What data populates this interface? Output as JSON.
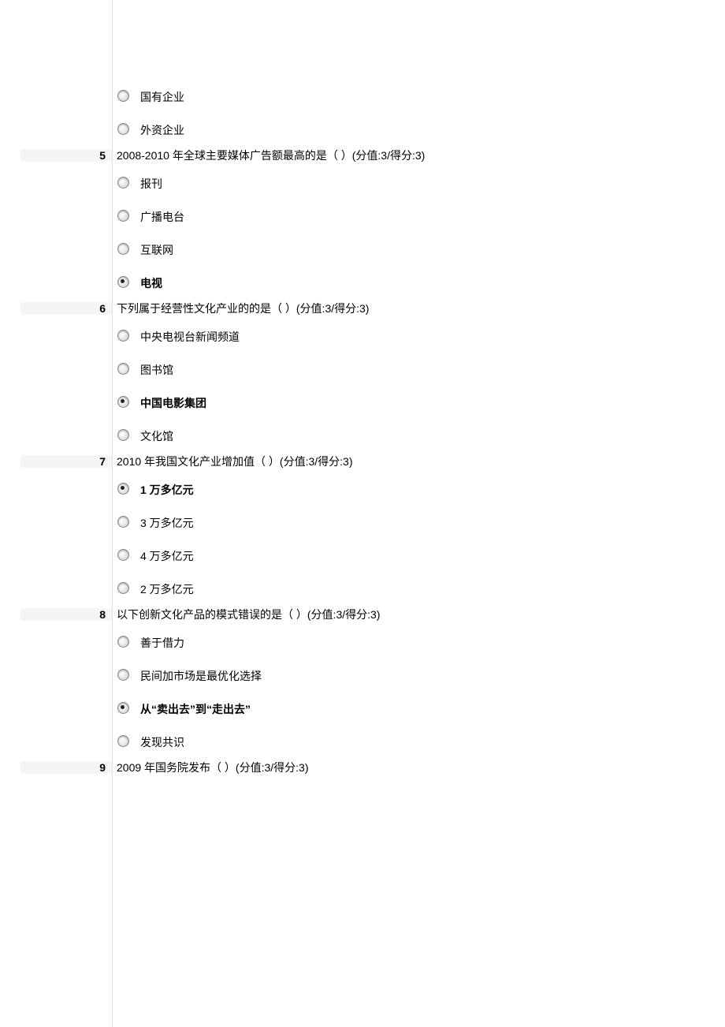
{
  "orphan_options": [
    {
      "label": "国有企业",
      "selected": false
    },
    {
      "label": "外资企业",
      "selected": false
    }
  ],
  "questions": [
    {
      "num": "5",
      "text": "2008-2010 年全球主要媒体广告额最高的是（ ）(分值:3/得分:3)",
      "options": [
        {
          "label": "报刊",
          "selected": false
        },
        {
          "label": "广播电台",
          "selected": false
        },
        {
          "label": "互联网",
          "selected": false
        },
        {
          "label": "电视",
          "selected": true
        }
      ]
    },
    {
      "num": "6",
      "text": "下列属于经营性文化产业的的是（ ）(分值:3/得分:3)",
      "options": [
        {
          "label": "中央电视台新闻频道",
          "selected": false
        },
        {
          "label": "图书馆",
          "selected": false
        },
        {
          "label": "中国电影集团",
          "selected": true
        },
        {
          "label": "文化馆",
          "selected": false
        }
      ]
    },
    {
      "num": "7",
      "text": "2010 年我国文化产业增加值（ ）(分值:3/得分:3)",
      "options": [
        {
          "label": "1 万多亿元",
          "selected": true
        },
        {
          "label": "3 万多亿元",
          "selected": false
        },
        {
          "label": "4 万多亿元",
          "selected": false
        },
        {
          "label": "2 万多亿元",
          "selected": false
        }
      ]
    },
    {
      "num": "8",
      "text": "以下创新文化产品的模式错误的是（ ）(分值:3/得分:3)",
      "options": [
        {
          "label": "善于借力",
          "selected": false
        },
        {
          "label": "民间加市场是最优化选择",
          "selected": false
        },
        {
          "label": "从“卖出去”到“走出去”",
          "selected": true
        },
        {
          "label": "发现共识",
          "selected": false
        }
      ]
    },
    {
      "num": "9",
      "text": "2009 年国务院发布（ ）(分值:3/得分:3)",
      "options": []
    }
  ]
}
